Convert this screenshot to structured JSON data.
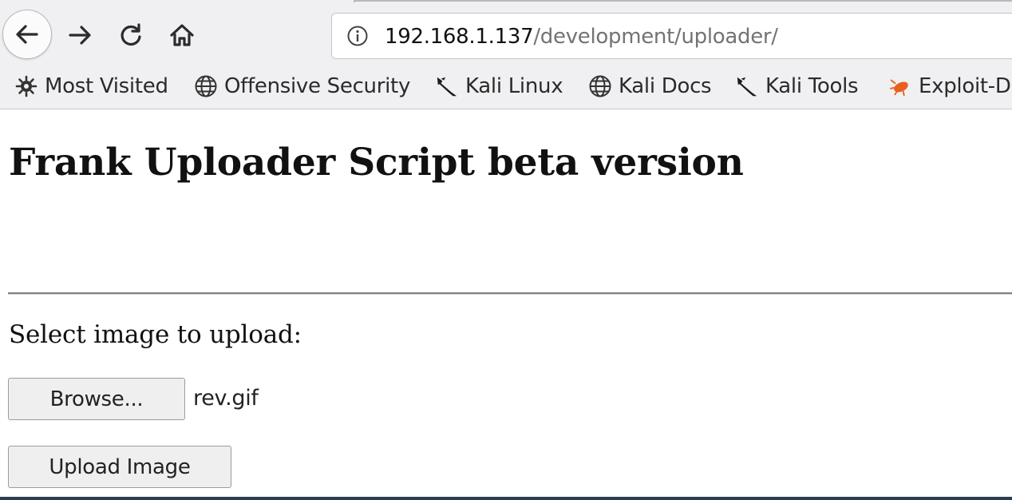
{
  "browser": {
    "url_host": "192.168.1.137",
    "url_path": "/development/uploader/",
    "nav_icons": [
      "back-arrow-icon",
      "forward-arrow-icon",
      "reload-icon",
      "home-icon"
    ],
    "info_icon": "info-icon",
    "bookmarks": [
      {
        "label": "Most Visited",
        "icon": "gear-icon"
      },
      {
        "label": "Offensive Security",
        "icon": "globe-icon"
      },
      {
        "label": "Kali Linux",
        "icon": "kali-dragon-icon"
      },
      {
        "label": "Kali Docs",
        "icon": "globe-icon"
      },
      {
        "label": "Kali Tools",
        "icon": "kali-dragon-icon"
      },
      {
        "label": "Exploit-D",
        "icon": "exploit-db-bug-icon"
      }
    ]
  },
  "page": {
    "title": "Frank Uploader Script beta version",
    "select_label": "Select image to upload:",
    "browse_label": "Browse...",
    "file_name": "rev.gif",
    "upload_label": "Upload Image"
  },
  "colors": {
    "chrome_bg": "#f0f0f2",
    "url_path": "#737373",
    "exploit_icon": "#e8601c"
  }
}
